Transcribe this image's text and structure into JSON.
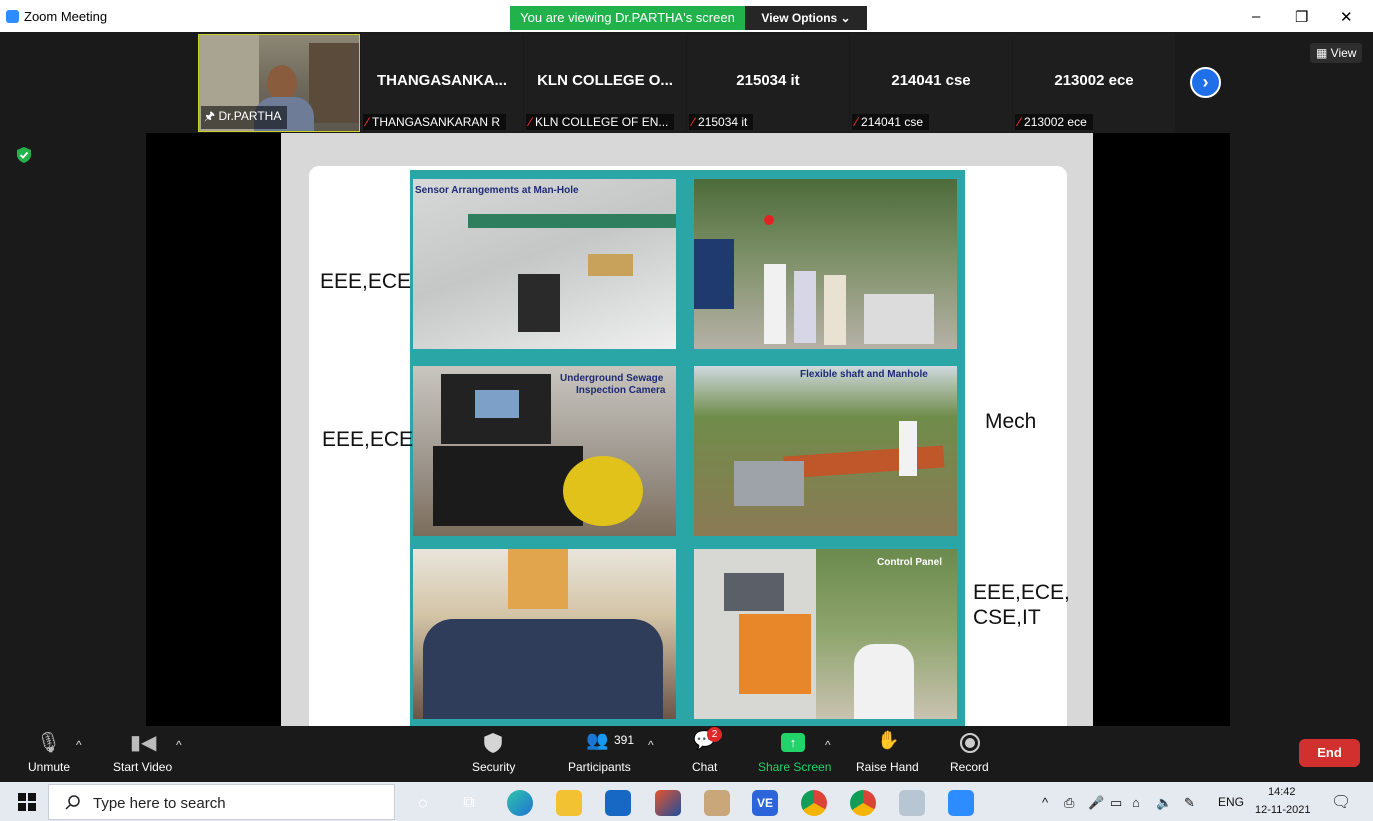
{
  "window": {
    "app_title": "Zoom Meeting",
    "viewing_banner": "You are viewing Dr.PARTHA's screen",
    "view_options": "View Options ⌄",
    "minimize": "–",
    "restore": "❐",
    "close": "✕",
    "view_button": "▦ View"
  },
  "participants": [
    {
      "display": "",
      "label": "Dr.PARTHA",
      "pinned": true
    },
    {
      "display": "THANGASANKA...",
      "label": "THANGASANKARAN R"
    },
    {
      "display": "KLN COLLEGE O...",
      "label": "KLN COLLEGE OF EN..."
    },
    {
      "display": "215034 it",
      "label": "215034 it"
    },
    {
      "display": "214041 cse",
      "label": "214041 cse"
    },
    {
      "display": "213002 ece",
      "label": "213002 ece"
    }
  ],
  "slide": {
    "captions": {
      "sensor": "Sensor Arrangements at Man-Hole",
      "camera_line1": "Underground Sewage",
      "camera_line2": "Inspection Camera",
      "shaft": "Flexible shaft and Manhole",
      "panel": "Control Panel"
    },
    "labels": {
      "row1_left": "EEE,ECE",
      "row2_left": "EEE,ECE",
      "row2_right": "Mech",
      "row3_right_line1": "EEE,ECE,",
      "row3_right_line2": "CSE,IT"
    }
  },
  "toolbar": {
    "unmute": "Unmute",
    "start_video": "Start Video",
    "security": "Security",
    "participants": "Participants",
    "participants_count": "391",
    "chat": "Chat",
    "chat_badge": "2",
    "share_screen": "Share Screen",
    "raise_hand": "Raise Hand",
    "record": "Record",
    "end": "End",
    "share_color": "#22d36a",
    "end_color": "#d22f2f"
  },
  "taskbar": {
    "search_placeholder": "Type here to search",
    "language": "ENG",
    "time": "14:42",
    "date": "12-11-2021"
  }
}
